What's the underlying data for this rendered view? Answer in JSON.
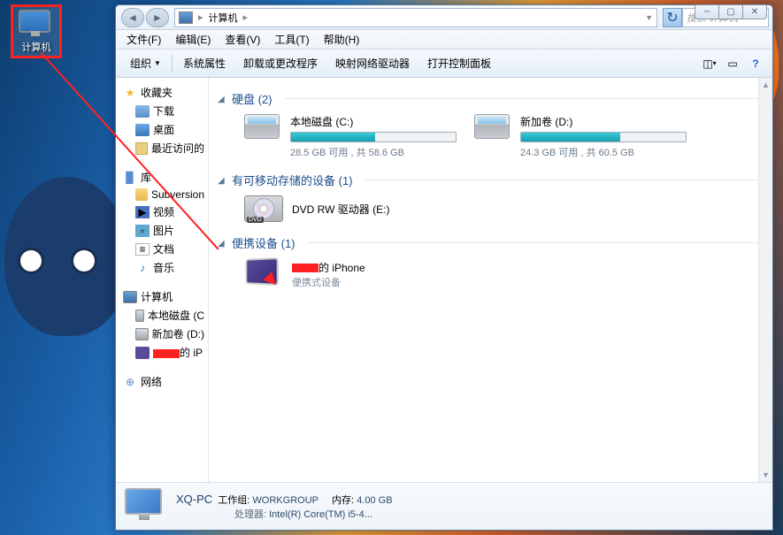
{
  "desktop_icon": {
    "label": "计算机"
  },
  "titlebar": {
    "breadcrumb": [
      "计算机"
    ],
    "search_placeholder": "搜索 计算机"
  },
  "menubar": {
    "file": "文件(F)",
    "edit": "编辑(E)",
    "view": "查看(V)",
    "tools": "工具(T)",
    "help": "帮助(H)"
  },
  "toolbar": {
    "organize": "组织",
    "properties": "系统属性",
    "uninstall": "卸载或更改程序",
    "map_drive": "映射网络驱动器",
    "control_panel": "打开控制面板"
  },
  "nav": {
    "favorites": "收藏夹",
    "downloads": "下载",
    "desktop": "桌面",
    "recent": "最近访问的",
    "libraries": "库",
    "subversion": "Subversion",
    "videos": "视频",
    "pictures": "图片",
    "documents": "文档",
    "music": "音乐",
    "computer": "计算机",
    "local_c": "本地磁盘 (C",
    "new_d": "新加卷 (D:)",
    "iphone_suffix": "的 iP",
    "network": "网络"
  },
  "content": {
    "groups": {
      "hard_disks": "硬盘 (2)",
      "removable": "有可移动存储的设备 (1)",
      "portable": "便携设备 (1)"
    },
    "drives": [
      {
        "name": "本地磁盘 (C:)",
        "free_text": "28.5 GB 可用 , 共 58.6 GB",
        "fill_pct": 51
      },
      {
        "name": "新加卷 (D:)",
        "free_text": "24.3 GB 可用 , 共 60.5 GB",
        "fill_pct": 60
      }
    ],
    "dvd": {
      "name": "DVD RW 驱动器 (E:)",
      "badge": "DVD"
    },
    "phone": {
      "name_suffix": "的 iPhone",
      "subtitle": "便携式设备"
    }
  },
  "details": {
    "name": "XQ-PC",
    "workgroup_label": "工作组:",
    "workgroup": "WORKGROUP",
    "memory_label": "内存:",
    "memory": "4.00 GB",
    "cpu_label": "处理器:",
    "cpu": "Intel(R) Core(TM) i5-4..."
  }
}
